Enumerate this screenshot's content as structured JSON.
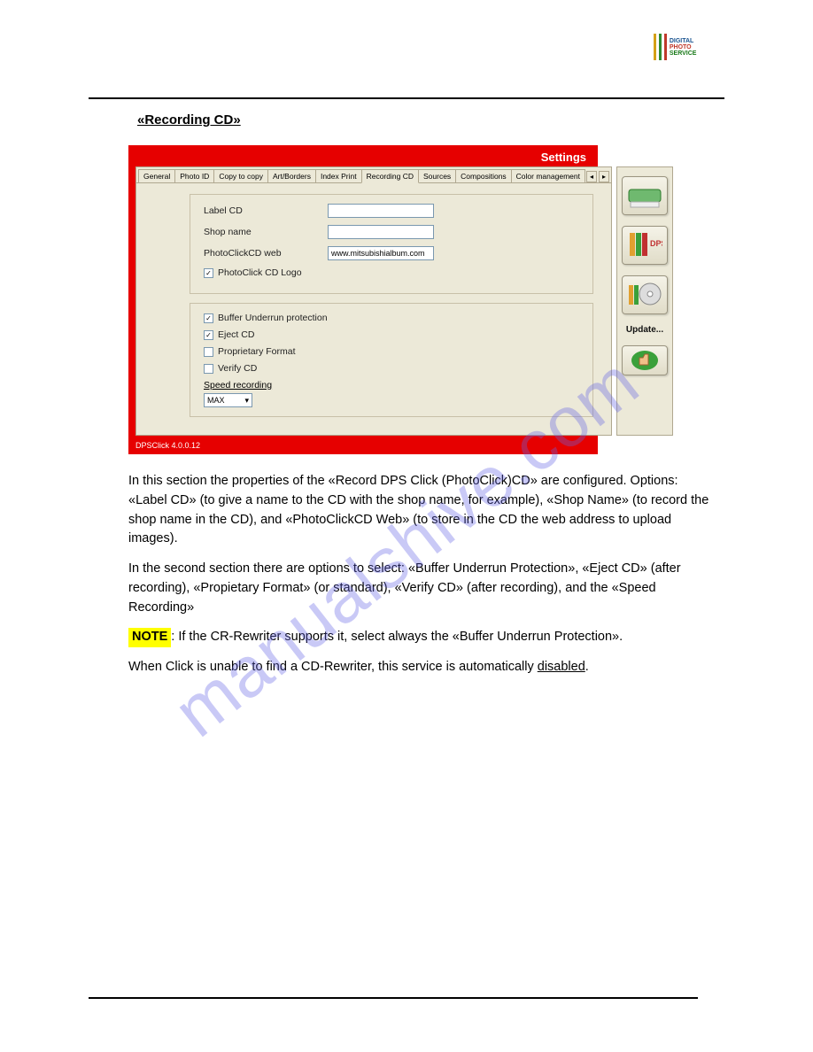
{
  "header": {
    "logo_lines": [
      "DIGITAL",
      "PHOTO",
      "SERVICE"
    ]
  },
  "section_title": "«Recording CD»",
  "app": {
    "settings_title": "Settings",
    "tabs": {
      "general": "General",
      "photo_id": "Photo ID",
      "copy_to_copy": "Copy to copy",
      "art_borders": "Art/Borders",
      "index_print": "Index Print",
      "recording_cd": "Recording CD",
      "sources": "Sources",
      "compositions": "Compositions",
      "color_management": "Color management"
    },
    "fields": {
      "label_cd": "Label CD",
      "label_cd_value": "",
      "shop_name": "Shop name",
      "shop_name_value": "",
      "photoclickcd_web": "PhotoClickCD web",
      "photoclickcd_web_value": "www.mitsubishialbum.com",
      "photoclick_cd_logo": "PhotoClick CD Logo",
      "buffer_underrun": "Buffer Underrun protection",
      "eject_cd": "Eject CD",
      "proprietary_format": "Proprietary Format",
      "verify_cd": "Verify CD",
      "speed_recording": "Speed recording",
      "speed_value": "MAX"
    },
    "check_mark": "✓",
    "dropdown_arrow": "▾",
    "side": {
      "update": "Update..."
    },
    "status": "DPSClick 4.0.0.12"
  },
  "body": {
    "p1": "In this section the properties of the «Record DPS Click (PhotoClick)CD» are configured. Options: «Label CD» (to give a name to the CD with the shop name, for example), «Shop Name» (to record the shop name in the CD), and «PhotoClickCD Web» (to store in the CD the web address to upload images).",
    "p2": "In the second section there are options to select: «Buffer Underrun Protection», «Eject CD» (after recording), «Propietary Format» (or standard), «Verify CD» (after recording), and the «Speed Recording»",
    "note_label": "NOTE",
    "note_text": ": If the CR-Rewriter supports it, select always the «Buffer Underrun Protection».",
    "p3a": "When Click is unable to find a CD-Rewriter, this service is automatically ",
    "p3b": "disabled",
    "p3c": "."
  },
  "watermark": "manualshive.com"
}
